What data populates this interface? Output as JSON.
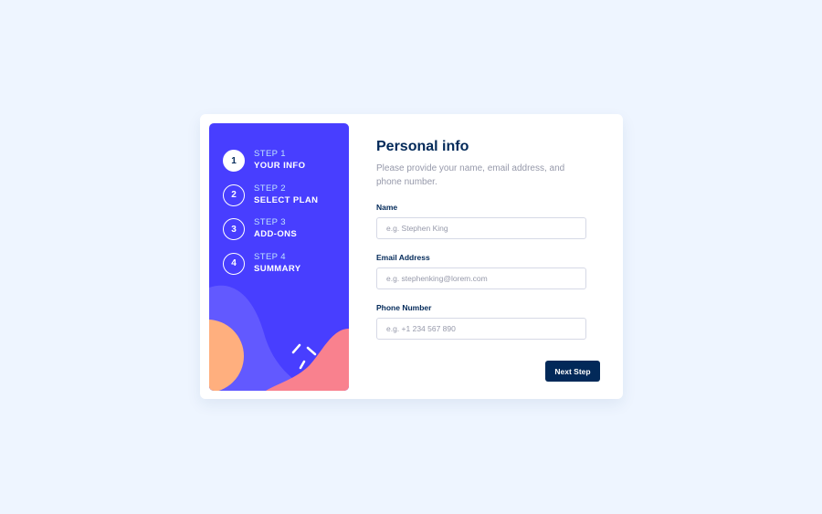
{
  "sidebar": {
    "steps": [
      {
        "number": "1",
        "label": "STEP 1",
        "title": "YOUR INFO",
        "active": true
      },
      {
        "number": "2",
        "label": "STEP 2",
        "title": "SELECT PLAN",
        "active": false
      },
      {
        "number": "3",
        "label": "STEP 3",
        "title": "ADD-ONS",
        "active": false
      },
      {
        "number": "4",
        "label": "STEP 4",
        "title": "SUMMARY",
        "active": false
      }
    ]
  },
  "form": {
    "title": "Personal info",
    "subtitle": "Please provide your name, email address, and phone number.",
    "fields": [
      {
        "label": "Name",
        "placeholder": "e.g. Stephen King",
        "value": ""
      },
      {
        "label": "Email Address",
        "placeholder": "e.g. stephenking@lorem.com",
        "value": ""
      },
      {
        "label": "Phone Number",
        "placeholder": "e.g. +1 234 567 890",
        "value": ""
      }
    ],
    "next_label": "Next Step"
  },
  "colors": {
    "page_bg": "#eef5ff",
    "sidebar_bg": "#483eff",
    "primary_dark": "#022959",
    "muted_text": "#9699aa",
    "border": "#d6d9e6",
    "deco_purple": "#6259ff",
    "deco_orange": "#ffaf7e",
    "deco_pink": "#f9818e"
  }
}
